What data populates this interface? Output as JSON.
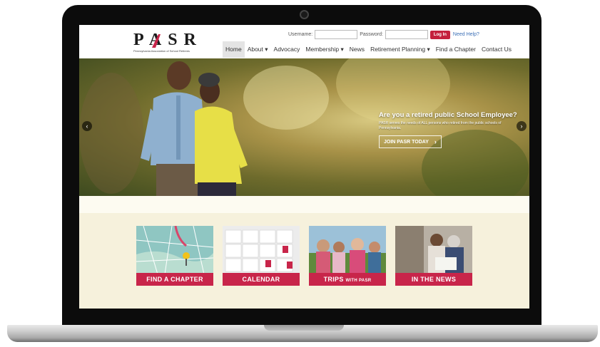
{
  "logo": {
    "text": "PASR",
    "tagline": "Pennsylvania Association of School Retirees"
  },
  "login": {
    "username_label": "Username:",
    "password_label": "Password:",
    "login_button": "Log In",
    "help_link": "Need Help?"
  },
  "nav": [
    {
      "label": "Home",
      "active": true
    },
    {
      "label": "About ▾"
    },
    {
      "label": "Advocacy"
    },
    {
      "label": "Membership ▾"
    },
    {
      "label": "News"
    },
    {
      "label": "Retirement Planning ▾"
    },
    {
      "label": "Find a Chapter"
    },
    {
      "label": "Contact Us"
    }
  ],
  "hero": {
    "title": "Are you a retired public School Employee?",
    "subtitle": "PASR serves the needs of ALL persons who retired from the public schools of Pennsylvania.",
    "button": "JOIN PASR TODAY",
    "prev_arrow": "‹",
    "next_arrow": "›"
  },
  "tiles": [
    {
      "caption": "FIND A CHAPTER",
      "caption_small": ""
    },
    {
      "caption": "CALENDAR",
      "caption_small": ""
    },
    {
      "caption": "TRIPS",
      "caption_small": "WITH PASR"
    },
    {
      "caption": "IN THE NEWS",
      "caption_small": ""
    }
  ],
  "colors": {
    "accent": "#c8254a",
    "band": "#f6f1dc",
    "link": "#3b6fb6"
  }
}
